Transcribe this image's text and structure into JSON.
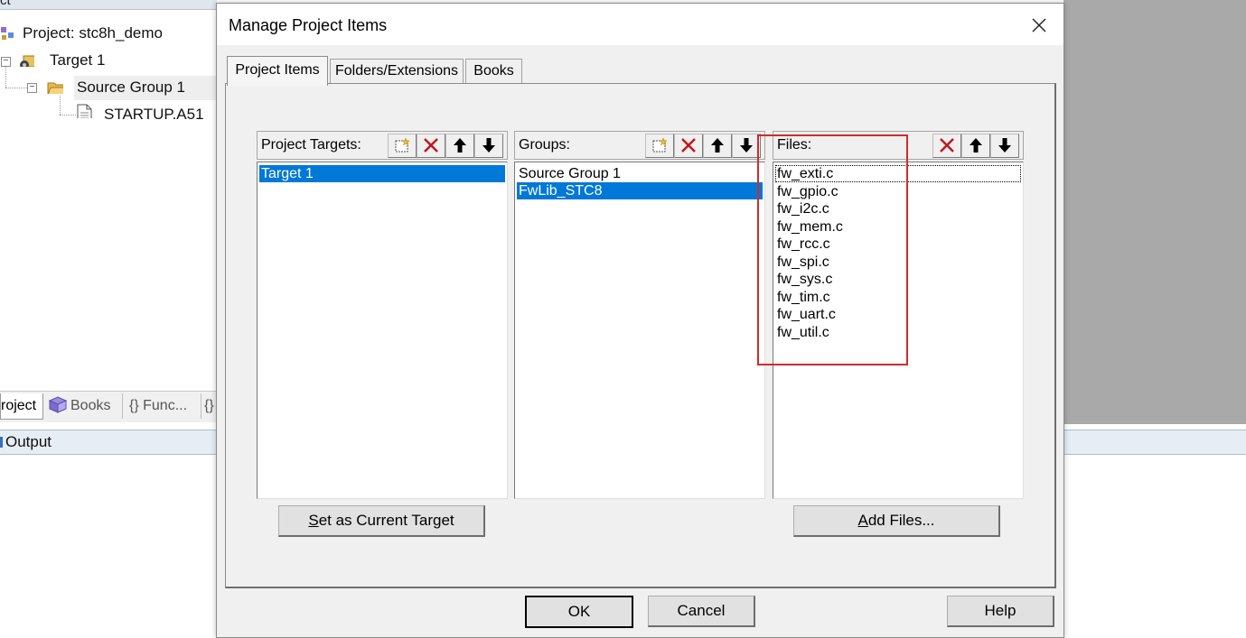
{
  "ide": {
    "panel_title_fragment": "ct",
    "tree": {
      "project": "Project: stc8h_demo",
      "target": "Target 1",
      "group": "Source Group 1",
      "file": "STARTUP.A51"
    },
    "bottom_tabs": [
      "roject",
      "Books",
      "{} Func...",
      "{}"
    ],
    "output_label": "Output"
  },
  "dialog": {
    "title": "Manage Project Items",
    "close_glyph": "✕",
    "tabs": [
      "Project Items",
      "Folders/Extensions",
      "Books"
    ],
    "active_tab": "Project Items",
    "targets": {
      "label": "Project Targets:",
      "items": [
        "Target 1"
      ],
      "selected": "Target 1"
    },
    "groups": {
      "label": "Groups:",
      "items": [
        "Source Group 1",
        "FwLib_STC8"
      ],
      "selected": "FwLib_STC8"
    },
    "files": {
      "label": "Files:",
      "items": [
        "fw_exti.c",
        "fw_gpio.c",
        "fw_i2c.c",
        "fw_mem.c",
        "fw_rcc.c",
        "fw_spi.c",
        "fw_sys.c",
        "fw_tim.c",
        "fw_uart.c",
        "fw_util.c"
      ],
      "focused": "fw_exti.c"
    },
    "buttons": {
      "set_target_prefix": "S",
      "set_target_rest": "et as Current Target",
      "add_files_prefix": "A",
      "add_files_rest": "dd Files...",
      "ok": "OK",
      "cancel": "Cancel",
      "help": "Help"
    }
  },
  "colors": {
    "selection": "#0078d7",
    "annotation": "#d12b2b"
  }
}
